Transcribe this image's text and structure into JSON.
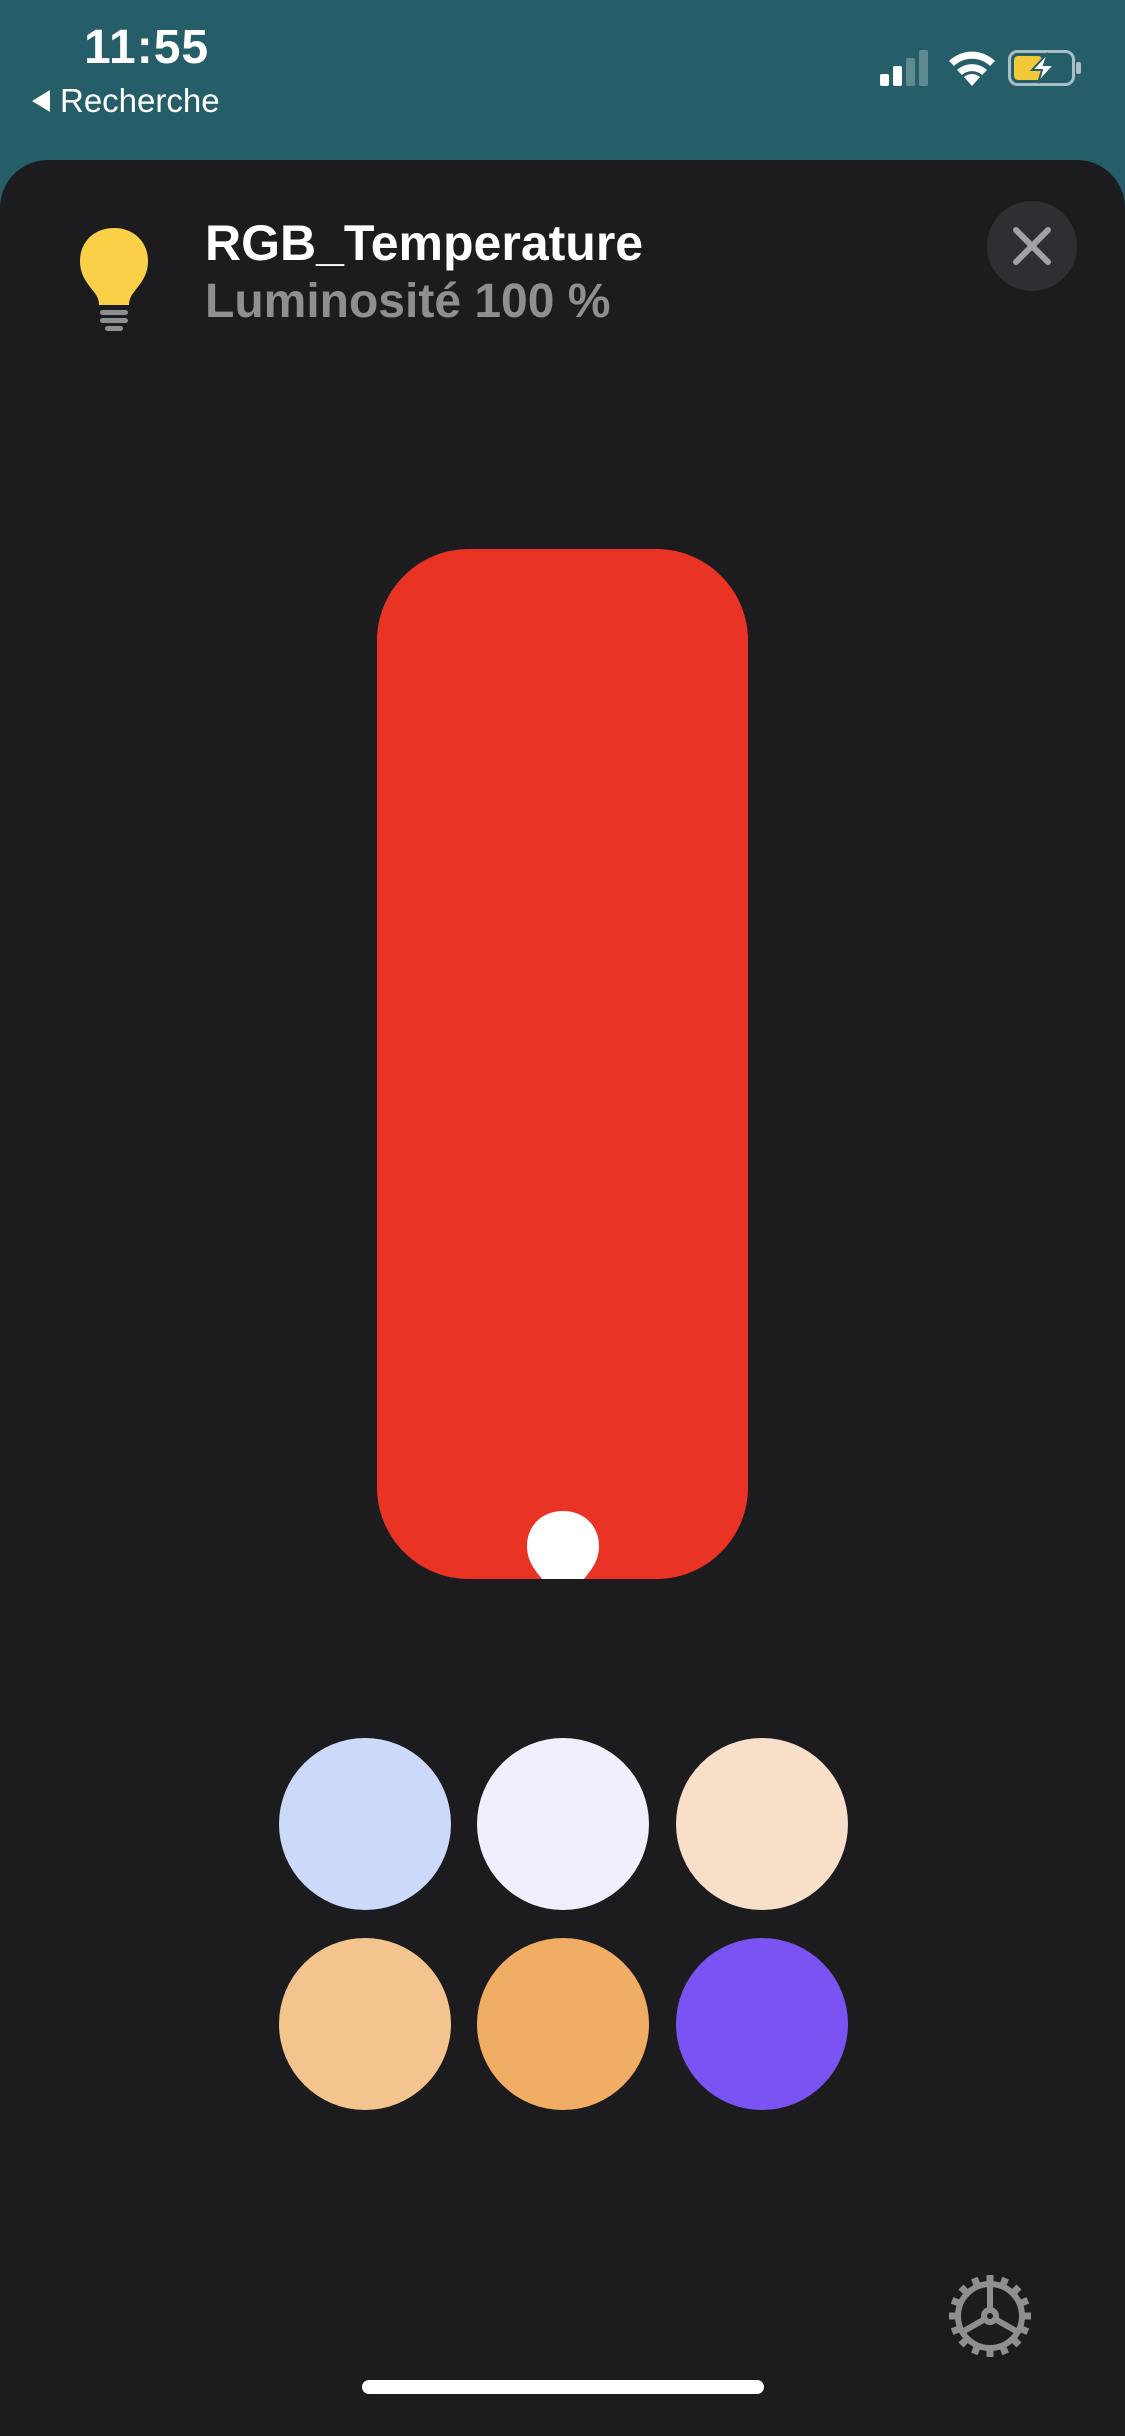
{
  "status_bar": {
    "time": "11:55",
    "back_label": "Recherche",
    "icons": [
      "signal-icon",
      "wifi-icon",
      "battery-charging-icon"
    ]
  },
  "header": {
    "title": "RGB_Temperature",
    "subtitle": "Luminosité 100 %",
    "icon": "lightbulb-icon",
    "icon_color": "#f9d047"
  },
  "brightness": {
    "level": 1.0,
    "color": "#e93324",
    "icon": "lightbulb-icon"
  },
  "swatches": [
    {
      "color": "#cbd9fb"
    },
    {
      "color": "#f0effd"
    },
    {
      "color": "#f8dfca"
    },
    {
      "color": "#f3c48e"
    },
    {
      "color": "#f1ad63"
    },
    {
      "color": "#7a54f3"
    }
  ],
  "colors": {
    "status_bg": "#255d68",
    "sheet_bg": "#1c1c1e",
    "subtitle": "#8e8e93"
  },
  "controls": {
    "close_icon": "close-icon",
    "settings_icon": "gear-icon"
  }
}
